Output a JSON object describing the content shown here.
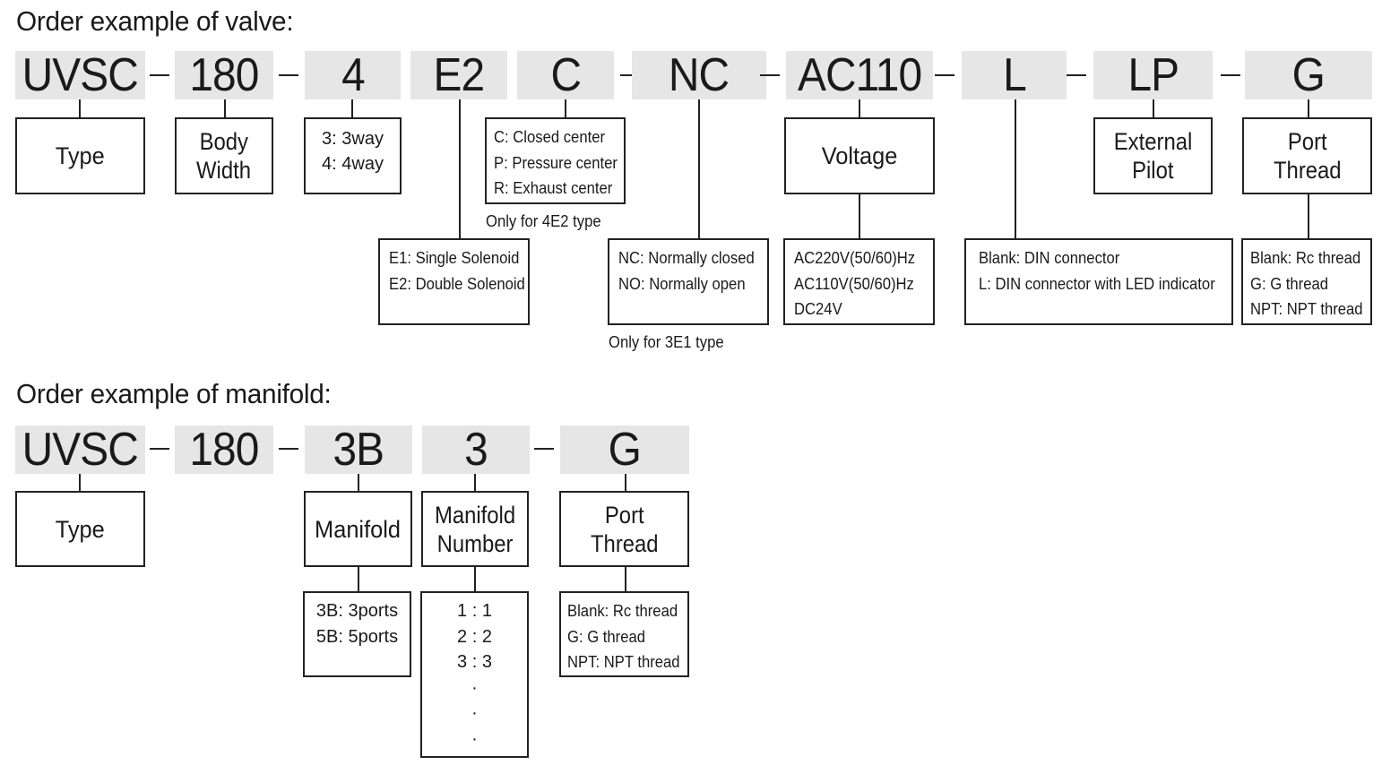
{
  "valve": {
    "title": "Order example of valve:",
    "codes": [
      "UVSC",
      "180",
      "4",
      "E2",
      "C",
      "NC",
      "AC110",
      "L",
      "LP",
      "G"
    ],
    "labels": {
      "type": "Type",
      "body_width": [
        "Body",
        "Width"
      ],
      "voltage": "Voltage",
      "external_pilot": [
        "External",
        "Pilot"
      ],
      "port_thread": [
        "Port",
        "Thread"
      ]
    },
    "options": {
      "ways": [
        "3: 3way",
        "4: 4way"
      ],
      "center": [
        "C: Closed center",
        "P: Pressure center",
        "R: Exhaust center"
      ],
      "solenoid": [
        "E1: Single Solenoid",
        "E2: Double Solenoid"
      ],
      "normally": [
        "NC: Normally closed",
        "NO: Normally open"
      ],
      "voltage": [
        "AC220V(50/60)Hz",
        "AC110V(50/60)Hz",
        "DC24V"
      ],
      "connector": [
        "Blank: DIN connector",
        "L: DIN connector with LED indicator"
      ],
      "thread": [
        "Blank: Rc thread",
        "G: G thread",
        "NPT: NPT thread"
      ]
    },
    "notes": {
      "center": "Only for 4E2 type",
      "normally": "Only for 3E1 type"
    }
  },
  "manifold": {
    "title": "Order example of manifold:",
    "codes": [
      "UVSC",
      "180",
      "3B",
      "3",
      "G"
    ],
    "labels": {
      "type": "Type",
      "manifold": "Manifold",
      "manifold_number": [
        "Manifold",
        "Number"
      ],
      "port_thread": [
        "Port",
        "Thread"
      ]
    },
    "options": {
      "ports": [
        "3B: 3ports",
        "5B: 5ports"
      ],
      "numbers": [
        "1 : 1",
        "2 : 2",
        "3 : 3",
        "·",
        "·",
        "·"
      ],
      "thread": [
        "Blank: Rc thread",
        "G: G thread",
        "NPT: NPT thread"
      ]
    }
  }
}
